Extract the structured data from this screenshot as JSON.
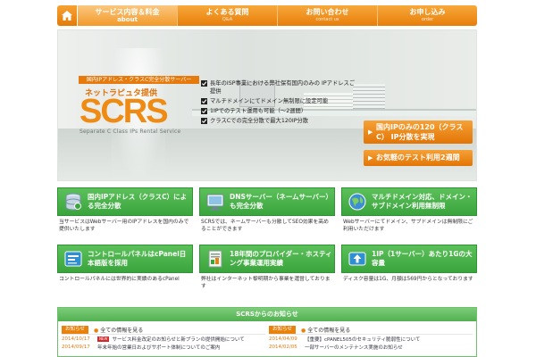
{
  "nav": {
    "home_icon": "home-icon",
    "items": [
      {
        "jp": "サービス内容＆料金",
        "en": "about"
      },
      {
        "jp": "よくある質問",
        "en": "Q&A"
      },
      {
        "jp": "お問い合わせ",
        "en": "contact us"
      },
      {
        "jp": "お申し込み",
        "en": "order"
      }
    ]
  },
  "hero": {
    "kicker": "国内IPアドレス・クラスC完全分散サーバー",
    "provider": "ネットラピュタ提供",
    "logo": "SCRS",
    "logo_sub": "Separate C Class IPs Rental Service",
    "features": [
      "長年のISP事業における弊社保有国内のみの IPアドレスご提供",
      "マルチドメインにてドメイン無制限に設定可能",
      "1IPでのテスト運用も可能（～2週間）",
      "クラスCでの完全分散で最大120IP分散"
    ],
    "cta_primary": "国内IPのみの120（クラスC） IP分散を実現",
    "cta_secondary": "お気軽のテスト利用2週間"
  },
  "cards": [
    {
      "icon": "database-icon",
      "title": "国内IPアドレス（クラスC）による完全分散",
      "body": "当サービスはWebサーバー用のIPアドレスを国内のみで提供いたします"
    },
    {
      "icon": "monitor-icon",
      "title": "DNSサーバー（ネームサーバー）も完全分散",
      "body": "SCRSでは、ネームサーバーも分散してSEO効果を高めることができます"
    },
    {
      "icon": "globe-icon",
      "title": "マルチドメイン対応、ドメイン・サブドメイン利用無制限",
      "body": "Webサーバーにてドメイン、サブドメインは無制限にご利用いただけます"
    },
    {
      "icon": "panel-icon",
      "title": "コントロールパネルはcPanel日本語版を採用",
      "body": "コントロールパネルには世界的に実績のあるcPanel"
    },
    {
      "icon": "document-icon",
      "title": "18年間のプロバイダー・ホスティング事業運用実績",
      "body": "弊社はインターネット黎明期から事業を運営しております"
    },
    {
      "icon": "upload-icon",
      "title": "1IP（1サーバー）あたり1Gの大容量",
      "body": "ディスク容量は1G、月額は569円からとなっております"
    }
  ],
  "news": {
    "title": "SCRSからのお知らせ",
    "columns": [
      {
        "tag": "お知らせ",
        "more": "全ての情報を見る",
        "rows": [
          {
            "date": "2014/10/17",
            "new": "NEW",
            "text": "サービス料金改定のお知らせと新プランの提供開始について"
          },
          {
            "date": "2014/09/17",
            "new": "",
            "text": "年末年始の営業日およびサポート体制についてのご案内"
          }
        ]
      },
      {
        "tag": "お知らせ",
        "more": "全ての情報を見る",
        "rows": [
          {
            "date": "2014/04/09",
            "new": "",
            "text": "【重要】cPANEL505のセキュリティ脆弱性について"
          },
          {
            "date": "2014/02/05",
            "new": "",
            "text": "一部サーバーのメンテナンス実施のお知らせ"
          }
        ]
      }
    ]
  },
  "colors": {
    "orange": "#e77e0b",
    "green": "#3aa43d"
  }
}
